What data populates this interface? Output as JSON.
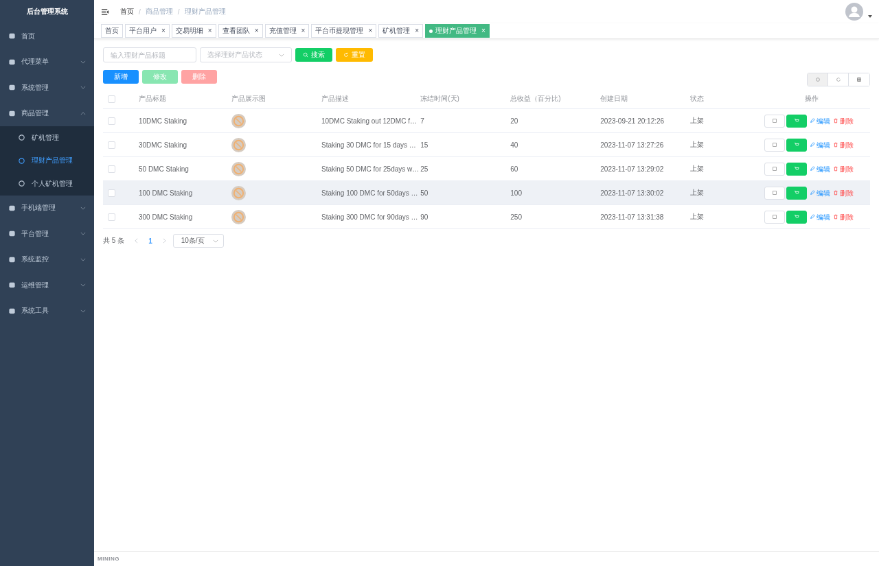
{
  "sidebar": {
    "title": "后台管理系统",
    "items": [
      {
        "label": "首页",
        "has_children": false
      },
      {
        "label": "代理菜单",
        "expanded": false,
        "has_children": true
      },
      {
        "label": "系统管理",
        "expanded": false,
        "has_children": true
      },
      {
        "label": "商品管理",
        "expanded": true,
        "has_children": true,
        "children": [
          {
            "label": "矿机管理",
            "selected": false
          },
          {
            "label": "理财产品管理",
            "selected": true
          },
          {
            "label": "个人矿机管理",
            "selected": false
          }
        ]
      },
      {
        "label": "手机端管理",
        "expanded": false,
        "has_children": true
      },
      {
        "label": "平台管理",
        "expanded": false,
        "has_children": true
      },
      {
        "label": "系统监控",
        "expanded": false,
        "has_children": true
      },
      {
        "label": "运维管理",
        "expanded": false,
        "has_children": true
      },
      {
        "label": "系统工具",
        "expanded": false,
        "has_children": true
      }
    ]
  },
  "breadcrumb": [
    {
      "label": "首页",
      "kind": "link"
    },
    {
      "label": "/",
      "kind": "separator"
    },
    {
      "label": "商品管理",
      "kind": "text"
    },
    {
      "label": "/",
      "kind": "separator"
    },
    {
      "label": "理财产品管理",
      "kind": "text"
    }
  ],
  "tags": [
    {
      "label": "首页",
      "selected": false
    },
    {
      "label": "平台用户",
      "selected": false,
      "close": "×"
    },
    {
      "label": "交易明细",
      "selected": false,
      "close": "×"
    },
    {
      "label": "查看团队",
      "selected": false,
      "close": "×"
    },
    {
      "label": "充值管理",
      "selected": false,
      "close": "×"
    },
    {
      "label": "平台币提现管理",
      "selected": false,
      "close": "×"
    },
    {
      "label": "矿机管理",
      "selected": false,
      "close": "×"
    },
    {
      "label": "理财产品管理",
      "selected": true,
      "close": "×"
    }
  ],
  "filters": {
    "title_placeholder": "输入理财产品标题",
    "status_placeholder": "选择理财产品状态",
    "search_button": "搜索",
    "reset_button": "重置"
  },
  "toolbar": [
    {
      "label": "新增",
      "kind": "add",
      "disabled": false
    },
    {
      "label": "修改",
      "kind": "edit",
      "disabled": true
    },
    {
      "label": "删除",
      "kind": "delete",
      "disabled": true
    }
  ],
  "table": {
    "all_checked": false,
    "columns": [
      "产品标题",
      "产品展示图",
      "产品描述",
      "冻结时间(天)",
      "总收益（百分比)",
      "创建日期",
      "状态",
      "操作"
    ],
    "rows": [
      {
        "checked": false,
        "highlighted": false,
        "title": "10DMC Staking",
        "description": "10DMC Staking out 12DMC f…",
        "freeze_days": "7",
        "total_return": "20",
        "created": "2023-09-21 20:12:26",
        "status": "上架",
        "edit": "编辑",
        "delete": "删除"
      },
      {
        "checked": false,
        "highlighted": false,
        "title": "30DMC Staking",
        "description": "Staking 30 DMC for 15 days …",
        "freeze_days": "15",
        "total_return": "40",
        "created": "2023-11-07 13:27:26",
        "status": "上架",
        "edit": "编辑",
        "delete": "删除"
      },
      {
        "checked": false,
        "highlighted": false,
        "title": "50 DMC Staking",
        "description": "Staking 50 DMC for 25days w…",
        "freeze_days": "25",
        "total_return": "60",
        "created": "2023-11-07 13:29:02",
        "status": "上架",
        "edit": "编辑",
        "delete": "删除"
      },
      {
        "checked": false,
        "highlighted": true,
        "title": "100 DMC Staking",
        "description": "Staking 100 DMC for 50days …",
        "freeze_days": "50",
        "total_return": "100",
        "created": "2023-11-07 13:30:02",
        "status": "上架",
        "edit": "编辑",
        "delete": "删除"
      },
      {
        "checked": false,
        "highlighted": false,
        "title": "300 DMC Staking",
        "description": "Staking 300 DMC for 90days …",
        "freeze_days": "90",
        "total_return": "250",
        "created": "2023-11-07 13:31:38",
        "status": "上架",
        "edit": "编辑",
        "delete": "删除"
      }
    ]
  },
  "pagination": {
    "total": "共 5 条",
    "pages": [
      {
        "label": "1",
        "selected": true
      }
    ],
    "page_size": "10条/页"
  },
  "footer": "MINING"
}
